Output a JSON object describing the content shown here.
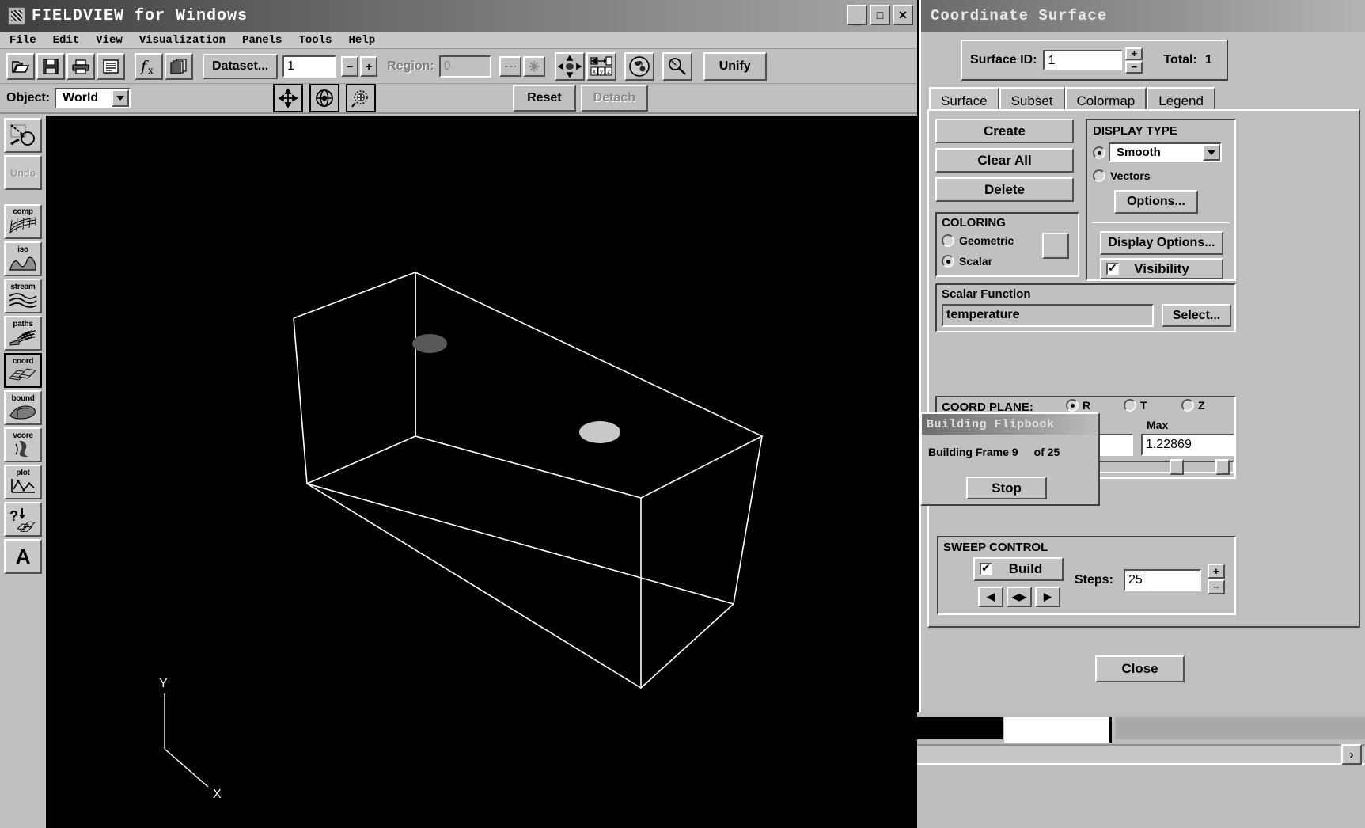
{
  "app": {
    "title": "FIELDVIEW for Windows",
    "window_buttons": [
      {
        "name": "minimize",
        "glyph": "_"
      },
      {
        "name": "maximize",
        "glyph": "□"
      },
      {
        "name": "close",
        "glyph": "✕"
      }
    ],
    "menu": [
      "File",
      "Edit",
      "View",
      "Visualization",
      "Panels",
      "Tools",
      "Help"
    ],
    "toolbar": {
      "icons": [
        "open-icon",
        "save-icon",
        "print-icon",
        "list-icon",
        "function-icon",
        "copy-icon"
      ],
      "dataset_label": "Dataset...",
      "dataset_value": "1",
      "minus": "−",
      "plus": "+",
      "region_label": "Region:",
      "region_value": "0",
      "extra_icons": [
        "dashes-icon",
        "asterisk-icon",
        "move-axes-icon",
        "xyz-transform-icon",
        "colorwheel-icon",
        "pick-icon"
      ],
      "unify_label": "Unify"
    },
    "toolbar2": {
      "object_label": "Object:",
      "object_value": "World",
      "icons": [
        "pan-icon",
        "rotate-icon",
        "zoom-region-icon"
      ],
      "reset_label": "Reset",
      "detach_label": "Detach"
    },
    "rail": [
      {
        "name": "zoom-tool",
        "cap": ""
      },
      {
        "name": "undo-tool",
        "cap": "Undo",
        "disabled": true
      },
      {
        "name": "computational-surface-tool",
        "cap": "comp"
      },
      {
        "name": "iso-surface-tool",
        "cap": "iso"
      },
      {
        "name": "streamline-tool",
        "cap": "stream"
      },
      {
        "name": "particle-paths-tool",
        "cap": "paths"
      },
      {
        "name": "coordinate-surface-tool",
        "cap": "coord",
        "selected": true
      },
      {
        "name": "boundary-surface-tool",
        "cap": "bound"
      },
      {
        "name": "vortex-core-tool",
        "cap": "vcore"
      },
      {
        "name": "plot-tool",
        "cap": "plot"
      },
      {
        "name": "threshold-tool",
        "cap": "?"
      },
      {
        "name": "annotation-tool",
        "cap": "A"
      }
    ],
    "viewport": {
      "axis_labels": [
        "Y",
        "X"
      ],
      "background": "#000000",
      "wireframe_color": "#ffffff"
    }
  },
  "coordinate_surface": {
    "title": "Coordinate Surface",
    "surface_id_label": "Surface ID:",
    "surface_id_value": "1",
    "total_label": "Total:",
    "total_value": "1",
    "spin_plus": "+",
    "spin_minus": "−",
    "tabs": [
      {
        "label": "Surface",
        "active": true
      },
      {
        "label": "Subset",
        "active": false
      },
      {
        "label": "Colormap",
        "active": false
      },
      {
        "label": "Legend",
        "active": false
      }
    ],
    "actions": [
      "Create",
      "Clear All",
      "Delete"
    ],
    "coloring": {
      "title": "COLORING",
      "options": [
        {
          "label": "Geometric",
          "selected": false
        },
        {
          "label": "Scalar",
          "selected": true
        }
      ]
    },
    "display_type": {
      "title": "DISPLAY TYPE",
      "smooth_selected": true,
      "smooth_value": "Smooth",
      "vectors_label": "Vectors",
      "vectors_selected": false,
      "options_label": "Options..."
    },
    "display_options_label": "Display Options...",
    "visibility_label": "Visibility",
    "visibility_checked": true,
    "scalar_function": {
      "title": "Scalar Function",
      "value": "temperature",
      "select_label": "Select..."
    },
    "coord_plane": {
      "label": "COORD PLANE:",
      "options": [
        {
          "label": "R",
          "selected": true
        },
        {
          "label": "T",
          "selected": false
        },
        {
          "label": "Z",
          "selected": false
        }
      ],
      "max_label": "Max",
      "max_value": "1.22869"
    },
    "sweep_control": {
      "title": "SWEEP CONTROL",
      "build_label": "Build",
      "build_checked": true,
      "nav_buttons": [
        "◀",
        "◀▶",
        "▶"
      ],
      "steps_label": "Steps:",
      "steps_value": "25",
      "plus": "+",
      "minus": "−"
    },
    "close_label": "Close"
  },
  "flipbook": {
    "title": "Building Flipbook",
    "status_prefix": "Building Frame 9",
    "status_suffix": "of 25",
    "stop_label": "Stop"
  },
  "colors": {
    "face": "#c0c0c0",
    "shadow": "#404040",
    "highlight": "#ffffff",
    "viewport_bg": "#000000",
    "titlebar_active": "#3f3f3f",
    "titlebar_inactive": "#8e8e8e"
  }
}
